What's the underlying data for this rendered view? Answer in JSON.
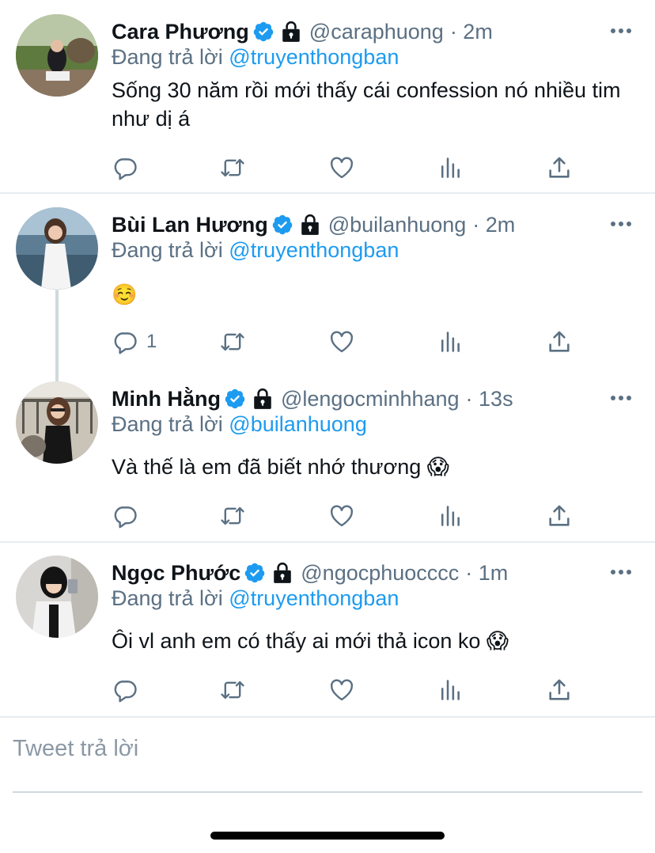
{
  "colors": {
    "accent": "#1d9bf0",
    "secondary_text": "#5b7083",
    "divider": "#e6ecf0"
  },
  "replying_prefix": "Đang trả lời",
  "tweets": [
    {
      "name": "Cara Phương",
      "handle": "@caraphuong",
      "time": "· 2m",
      "reply_to": "@truyenthongban",
      "text": "Sống 30 năm rồi mới thấy cái confession nó nhiều tim như dị á",
      "reply_count": ""
    },
    {
      "name": "Bùi Lan Hương",
      "handle": "@builanhuong",
      "time": "· 2m",
      "reply_to": "@truyenthongban",
      "text": "☺️",
      "reply_count": "1"
    },
    {
      "name": "Minh Hằng",
      "handle": "@lengocminhhang",
      "time": "· 13s",
      "reply_to": "@builanhuong",
      "text": "Và thế là em đã biết nhớ thương 😱",
      "reply_count": ""
    },
    {
      "name": "Ngọc Phước",
      "handle": "@ngocphuocccc",
      "time": "· 1m",
      "reply_to": "@truyenthongban",
      "text": "Ôi vl anh em có thấy ai mới thả icon ko 😱",
      "reply_count": ""
    }
  ],
  "icons": [
    "verified-badge-icon",
    "lock-icon",
    "more-icon",
    "reply-icon",
    "retweet-icon",
    "like-icon",
    "analytics-icon",
    "share-icon"
  ],
  "reply_box": {
    "placeholder": "Tweet trả lời"
  }
}
